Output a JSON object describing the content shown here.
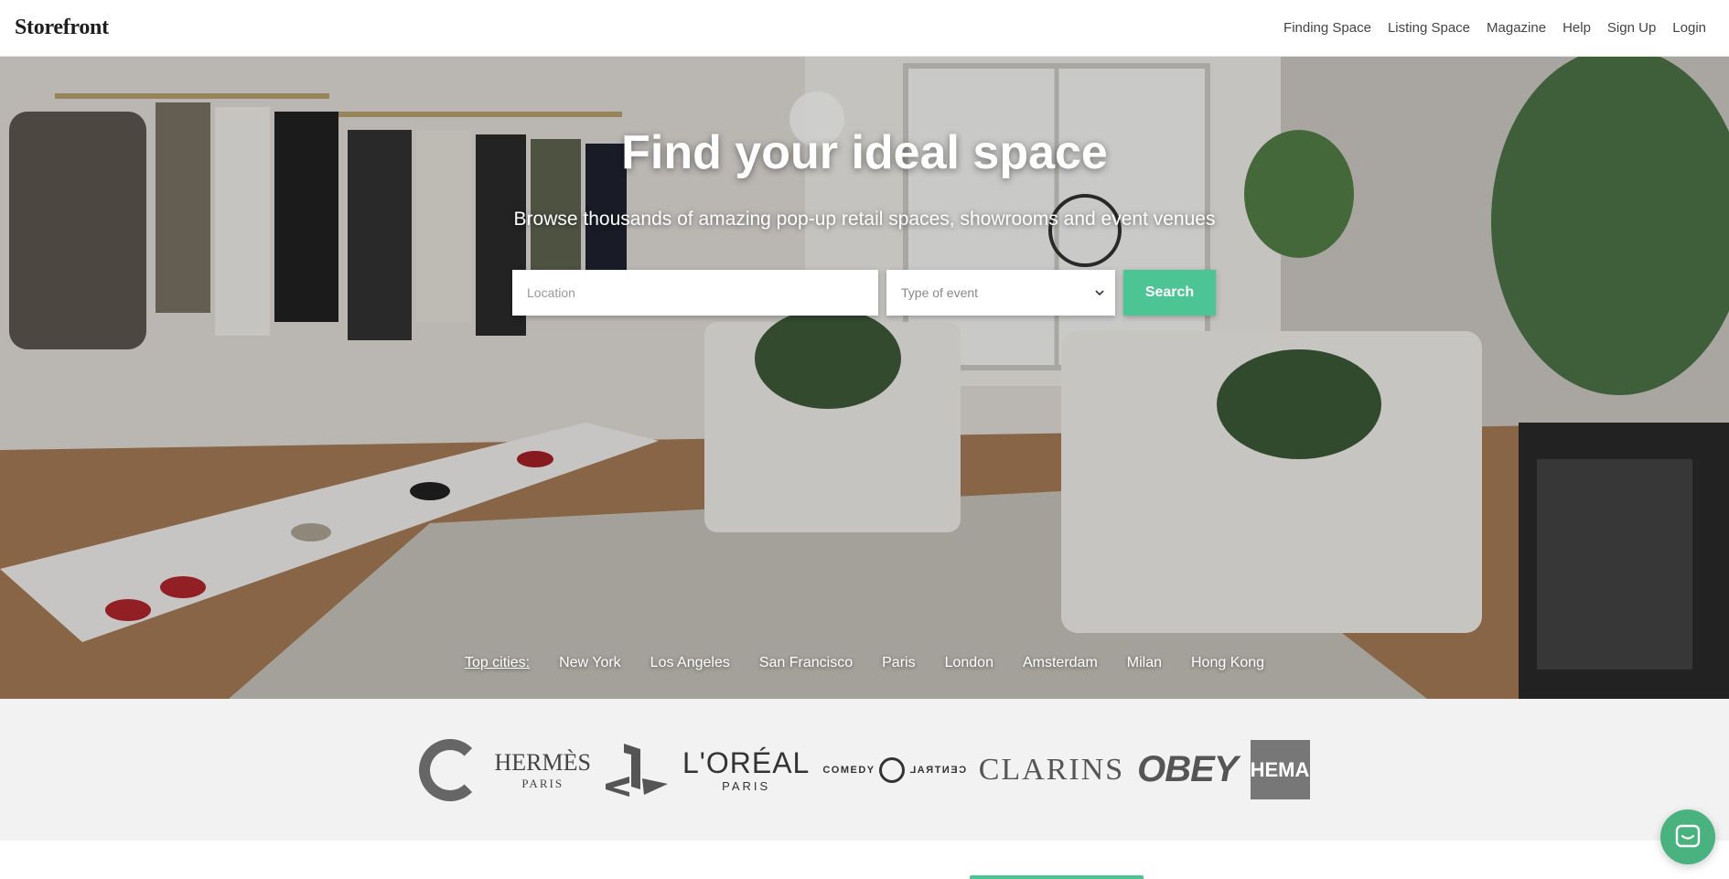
{
  "header": {
    "logo": "Storefront",
    "nav": [
      "Finding Space",
      "Listing Space",
      "Magazine",
      "Help",
      "Sign Up",
      "Login"
    ]
  },
  "hero": {
    "title": "Find your ideal space",
    "subtitle": "Browse thousands of amazing pop-up retail spaces, showrooms and event venues",
    "location_placeholder": "Location",
    "event_select_value": "Type of event",
    "search_label": "Search"
  },
  "cities": {
    "label": "Top cities:",
    "items": [
      "New York",
      "Los Angeles",
      "San Francisco",
      "Paris",
      "London",
      "Amsterdam",
      "Milan",
      "Hong Kong"
    ]
  },
  "brands": {
    "hermes": "HERMÈS",
    "hermes_sub": "PARIS",
    "loreal": "L'ORÉAL",
    "loreal_sub": "PARIS",
    "comedy_left": "COMEDY",
    "comedy_right": "CENTRAL",
    "clarins": "CLARINS",
    "obey": "OBEY",
    "hema": "HEMA"
  },
  "icons": {
    "chevron": "chevron-down-icon",
    "chat": "chat-bubble-icon",
    "g_logo": "g-logo-icon",
    "playstation": "playstation-logo-icon"
  },
  "colors": {
    "accent": "#4dc493",
    "chat": "#49b27f"
  }
}
